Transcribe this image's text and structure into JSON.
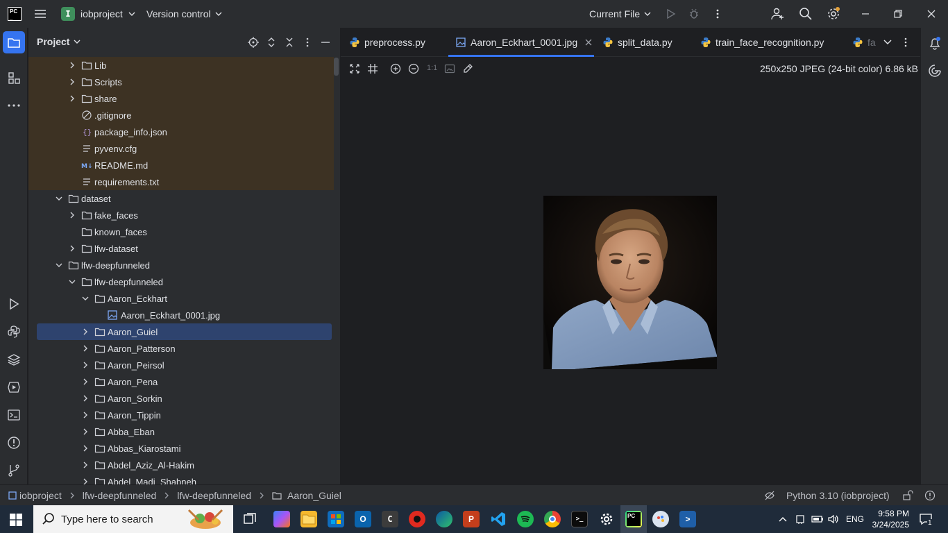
{
  "titlebar": {
    "project_letter": "I",
    "project_name": "iobproject",
    "vcs_label": "Version control",
    "run_config": "Current File"
  },
  "project_panel": {
    "title": "Project",
    "tree": [
      {
        "label": "Lib",
        "type": "folder",
        "expanded": false,
        "venv": true
      },
      {
        "label": "Scripts",
        "type": "folder",
        "expanded": false,
        "venv": true
      },
      {
        "label": "share",
        "type": "folder",
        "expanded": false,
        "venv": true
      },
      {
        "label": ".gitignore",
        "type": "ignore-file",
        "venv": true
      },
      {
        "label": "package_info.json",
        "type": "json-file",
        "venv": true
      },
      {
        "label": "pyvenv.cfg",
        "type": "text-file",
        "venv": true
      },
      {
        "label": "README.md",
        "type": "markdown-file",
        "venv": true
      },
      {
        "label": "requirements.txt",
        "type": "text-file",
        "venv": true
      },
      {
        "label": "dataset",
        "type": "folder",
        "expanded": true
      },
      {
        "label": "fake_faces",
        "type": "folder",
        "expanded": false
      },
      {
        "label": "known_faces",
        "type": "folder"
      },
      {
        "label": "lfw-dataset",
        "type": "folder",
        "expanded": false
      },
      {
        "label": "lfw-deepfunneled",
        "type": "folder",
        "expanded": true
      },
      {
        "label": "lfw-deepfunneled",
        "type": "folder",
        "expanded": true
      },
      {
        "label": "Aaron_Eckhart",
        "type": "folder",
        "expanded": true
      },
      {
        "label": "Aaron_Eckhart_0001.jpg",
        "type": "image-file"
      },
      {
        "label": "Aaron_Guiel",
        "type": "folder",
        "expanded": false,
        "selected": true
      },
      {
        "label": "Aaron_Patterson",
        "type": "folder",
        "expanded": false
      },
      {
        "label": "Aaron_Peirsol",
        "type": "folder",
        "expanded": false
      },
      {
        "label": "Aaron_Pena",
        "type": "folder",
        "expanded": false
      },
      {
        "label": "Aaron_Sorkin",
        "type": "folder",
        "expanded": false
      },
      {
        "label": "Aaron_Tippin",
        "type": "folder",
        "expanded": false
      },
      {
        "label": "Abba_Eban",
        "type": "folder",
        "expanded": false
      },
      {
        "label": "Abbas_Kiarostami",
        "type": "folder",
        "expanded": false
      },
      {
        "label": "Abdel_Aziz_Al-Hakim",
        "type": "folder",
        "expanded": false
      },
      {
        "label": "Abdel_Madi_Shabneh",
        "type": "folder",
        "expanded": false
      }
    ]
  },
  "editor": {
    "tabs": [
      {
        "label": "preprocess.py",
        "icon": "python-icon"
      },
      {
        "label": "Aaron_Eckhart_0001.jpg",
        "icon": "image-icon",
        "active": true
      },
      {
        "label": "split_data.py",
        "icon": "python-icon"
      },
      {
        "label": "train_face_recognition.py",
        "icon": "python-icon"
      },
      {
        "label": "fa",
        "icon": "python-icon"
      }
    ],
    "zoom_actual": "1:1",
    "image_info": "250x250 JPEG (24-bit color) 6.86 kB"
  },
  "statusbar": {
    "breadcrumb": [
      "iobproject",
      "lfw-deepfunneled",
      "lfw-deepfunneled",
      "Aaron_Guiel"
    ],
    "interpreter": "Python 3.10 (iobproject)"
  },
  "taskbar": {
    "search_placeholder": "Type here to search",
    "language": "ENG",
    "time": "9:58 PM",
    "date": "3/24/2025",
    "notification_count": "1"
  },
  "colors": {
    "accent": "#3574f0",
    "venv_highlight": "#3d3223",
    "selection": "#2e436e",
    "panel_bg": "#2b2d30",
    "editor_bg": "#1e1f22"
  }
}
